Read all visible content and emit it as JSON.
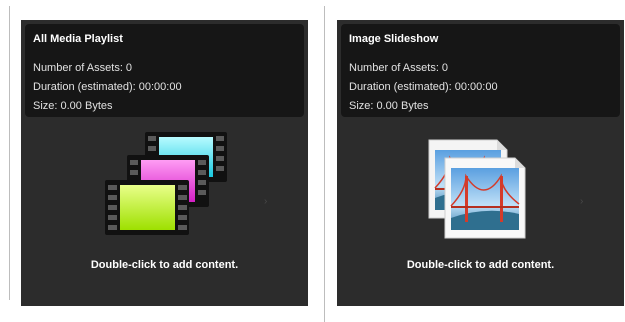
{
  "colors": {
    "card_bg": "#2c2c2c",
    "info_bg": "#161616",
    "text": "#ffffff"
  },
  "cards": [
    {
      "title": "All Media Playlist",
      "assets": "Number of Assets: 0",
      "duration": "Duration (estimated): 00:00:00",
      "size": "Size: 0.00 Bytes",
      "hint": "Double-click to add content.",
      "icon": "media-playlist-icon"
    },
    {
      "title": "Image Slideshow",
      "assets": "Number of Assets: 0",
      "duration": "Duration (estimated): 00:00:00",
      "size": "Size: 0.00 Bytes",
      "hint": "Double-click to add content.",
      "icon": "image-slideshow-icon"
    }
  ]
}
